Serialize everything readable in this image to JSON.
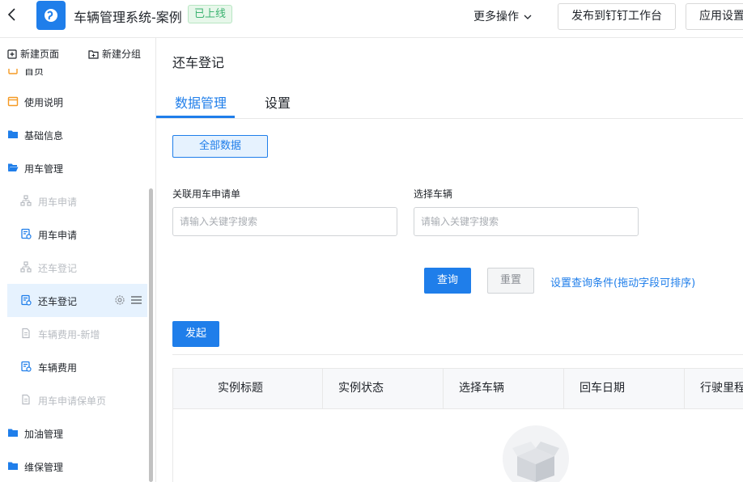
{
  "header": {
    "app_title": "车辆管理系统-案例",
    "status_badge": "已上线",
    "more_actions": "更多操作",
    "publish_button": "发布到钉钉工作台",
    "app_settings_button": "应用设置"
  },
  "sidebar": {
    "new_page": "新建页面",
    "new_group": "新建分组",
    "items": [
      {
        "label": "首页",
        "level": 1,
        "icon": "home-icon"
      },
      {
        "label": "使用说明",
        "level": 1,
        "icon": "calendar-icon"
      },
      {
        "label": "基础信息",
        "level": 1,
        "icon": "folder-icon"
      },
      {
        "label": "用车管理",
        "level": 1,
        "icon": "folder-open-icon"
      },
      {
        "label": "用车申请",
        "level": 2,
        "icon": "flow-icon",
        "dim": true
      },
      {
        "label": "用车申请",
        "level": 2,
        "icon": "form-icon"
      },
      {
        "label": "还车登记",
        "level": 2,
        "icon": "flow-icon",
        "dim": true
      },
      {
        "label": "还车登记",
        "level": 2,
        "icon": "form-icon",
        "active": true
      },
      {
        "label": "车辆费用-新增",
        "level": 2,
        "icon": "doc-icon",
        "dim": true
      },
      {
        "label": "车辆费用",
        "level": 2,
        "icon": "form-icon"
      },
      {
        "label": "用车申请保单页",
        "level": 2,
        "icon": "doc-icon",
        "dim": true
      },
      {
        "label": "加油管理",
        "level": 1,
        "icon": "folder-icon"
      },
      {
        "label": "维保管理",
        "level": 1,
        "icon": "folder-icon"
      }
    ]
  },
  "main": {
    "page_title": "还车登记",
    "tabs": [
      {
        "label": "数据管理",
        "active": true
      },
      {
        "label": "设置",
        "active": false
      }
    ],
    "view_button": "全部数据",
    "filters": [
      {
        "label": "关联用车申请单",
        "placeholder": "请输入关键字搜索"
      },
      {
        "label": "选择车辆",
        "placeholder": "请输入关键字搜索"
      }
    ],
    "query_button": "查询",
    "reset_button": "重置",
    "query_settings_link": "设置查询条件(拖动字段可排序)",
    "start_button": "发起",
    "table_columns": [
      "实例标题",
      "实例状态",
      "选择车辆",
      "回车日期",
      "行驶里程"
    ]
  },
  "colors": {
    "accent": "#1f7eea",
    "active_bg": "#e6f2fe",
    "badge_green": "#3cb371"
  }
}
